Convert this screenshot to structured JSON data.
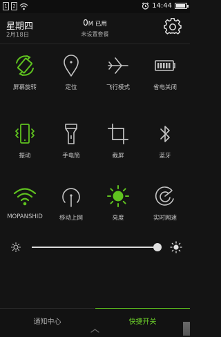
{
  "status_bar": {
    "sim1": "1",
    "sim2": "2",
    "time": "14:44"
  },
  "header": {
    "weekday": "星期四",
    "date": "2月18日",
    "data_value": "0",
    "data_unit": "M 已用",
    "plan": "未设置套餐"
  },
  "tiles": [
    {
      "label": "屏幕旋转",
      "icon": "screen-rotation-icon",
      "active": true
    },
    {
      "label": "定位",
      "icon": "location-pin-icon",
      "active": false
    },
    {
      "label": "飞行模式",
      "icon": "airplane-icon",
      "active": false
    },
    {
      "label": "省电关闭",
      "icon": "battery-icon",
      "active": false
    },
    {
      "label": "振动",
      "icon": "vibrate-icon",
      "active": true
    },
    {
      "label": "手电筒",
      "icon": "flashlight-icon",
      "active": false
    },
    {
      "label": "截屏",
      "icon": "crop-icon",
      "active": false
    },
    {
      "label": "蓝牙",
      "icon": "bluetooth-icon",
      "active": false
    },
    {
      "label": "MOPANSHID",
      "icon": "wifi-icon",
      "active": true
    },
    {
      "label": "移动上网",
      "icon": "mobile-data-icon",
      "active": false
    },
    {
      "label": "亮度",
      "icon": "brightness-icon",
      "active": true
    },
    {
      "label": "实时网速",
      "icon": "network-speed-icon",
      "active": false
    }
  ],
  "brightness": {
    "level": 0.97
  },
  "tabs": {
    "notifications": "通知中心",
    "quick": "快捷开关"
  },
  "colors": {
    "accent": "#5fc21f",
    "inactive": "#c4c4c4",
    "background": "#141414"
  }
}
